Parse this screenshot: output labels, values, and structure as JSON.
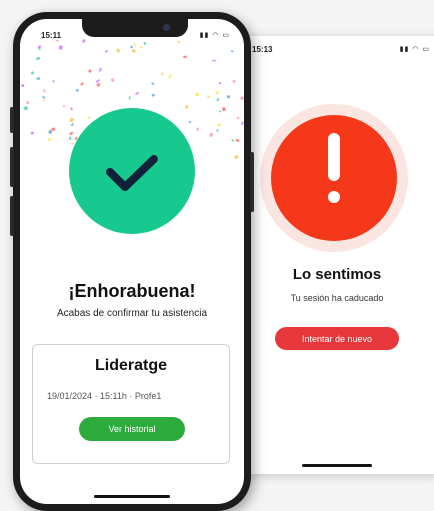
{
  "error_screen": {
    "status_time": "15:13",
    "status_icons": "▮▮ ◠ ▭",
    "alert_icon": "exclamation-icon",
    "title": "Lo sentimos",
    "subtitle": "Tu sesión ha caducado",
    "retry_label": "Intentar de nuevo",
    "colors": {
      "circle": "#f5371a",
      "button": "#e8373a"
    }
  },
  "success_screen": {
    "status_time": "15:11",
    "status_icons": "▮▮ ◠ ▭",
    "check_icon": "checkmark-icon",
    "title": "¡Enhorabuena!",
    "subtitle": "Acabas de confirmar tu asistencia",
    "card": {
      "title": "Lideratge",
      "meta": "19/01/2024 · 15:11h · Profe1",
      "history_label": "Ver historial"
    },
    "colors": {
      "circle": "#18c98f",
      "button": "#2eab3d"
    }
  }
}
